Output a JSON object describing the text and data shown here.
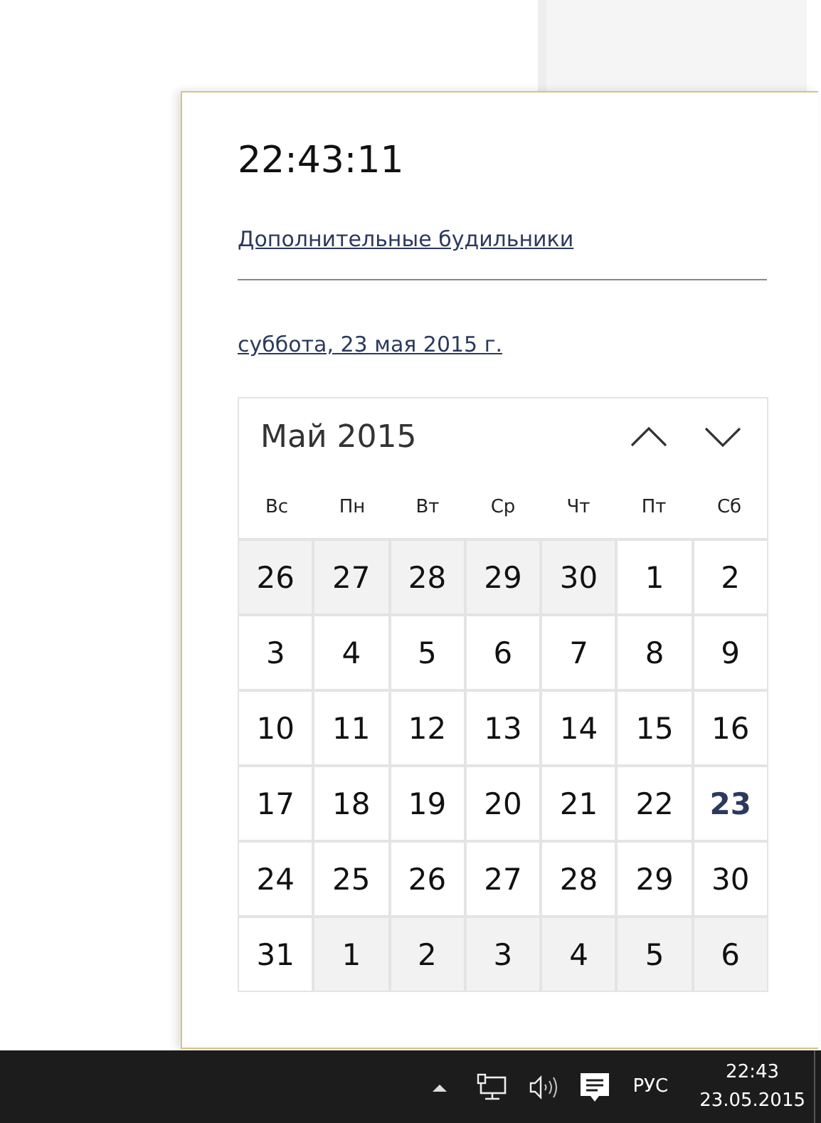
{
  "clock": {
    "time": "22:43:11",
    "alarms_link": "Дополнительные будильники",
    "date_link": "суббота, 23 мая 2015 г."
  },
  "calendar": {
    "month": "Май 2015",
    "weekdays": [
      "Вс",
      "Пн",
      "Вт",
      "Ср",
      "Чт",
      "Пт",
      "Сб"
    ],
    "days": [
      {
        "label": "26",
        "kind": "other",
        "today": false
      },
      {
        "label": "27",
        "kind": "other",
        "today": false
      },
      {
        "label": "28",
        "kind": "other",
        "today": false
      },
      {
        "label": "29",
        "kind": "other",
        "today": false
      },
      {
        "label": "30",
        "kind": "other",
        "today": false
      },
      {
        "label": "1",
        "kind": "current",
        "today": false
      },
      {
        "label": "2",
        "kind": "current",
        "today": false
      },
      {
        "label": "3",
        "kind": "current",
        "today": false
      },
      {
        "label": "4",
        "kind": "current",
        "today": false
      },
      {
        "label": "5",
        "kind": "current",
        "today": false
      },
      {
        "label": "6",
        "kind": "current",
        "today": false
      },
      {
        "label": "7",
        "kind": "current",
        "today": false
      },
      {
        "label": "8",
        "kind": "current",
        "today": false
      },
      {
        "label": "9",
        "kind": "current",
        "today": false
      },
      {
        "label": "10",
        "kind": "current",
        "today": false
      },
      {
        "label": "11",
        "kind": "current",
        "today": false
      },
      {
        "label": "12",
        "kind": "current",
        "today": false
      },
      {
        "label": "13",
        "kind": "current",
        "today": false
      },
      {
        "label": "14",
        "kind": "current",
        "today": false
      },
      {
        "label": "15",
        "kind": "current",
        "today": false
      },
      {
        "label": "16",
        "kind": "current",
        "today": false
      },
      {
        "label": "17",
        "kind": "current",
        "today": false
      },
      {
        "label": "18",
        "kind": "current",
        "today": false
      },
      {
        "label": "19",
        "kind": "current",
        "today": false
      },
      {
        "label": "20",
        "kind": "current",
        "today": false
      },
      {
        "label": "21",
        "kind": "current",
        "today": false
      },
      {
        "label": "22",
        "kind": "current",
        "today": false
      },
      {
        "label": "23",
        "kind": "current",
        "today": true
      },
      {
        "label": "24",
        "kind": "current",
        "today": false
      },
      {
        "label": "25",
        "kind": "current",
        "today": false
      },
      {
        "label": "26",
        "kind": "current",
        "today": false
      },
      {
        "label": "27",
        "kind": "current",
        "today": false
      },
      {
        "label": "28",
        "kind": "current",
        "today": false
      },
      {
        "label": "29",
        "kind": "current",
        "today": false
      },
      {
        "label": "30",
        "kind": "current",
        "today": false
      },
      {
        "label": "31",
        "kind": "current",
        "today": false
      },
      {
        "label": "1",
        "kind": "other",
        "today": false
      },
      {
        "label": "2",
        "kind": "other",
        "today": false
      },
      {
        "label": "3",
        "kind": "other",
        "today": false
      },
      {
        "label": "4",
        "kind": "other",
        "today": false
      },
      {
        "label": "5",
        "kind": "other",
        "today": false
      },
      {
        "label": "6",
        "kind": "other",
        "today": false
      }
    ]
  },
  "taskbar": {
    "language": "РУС",
    "time": "22:43",
    "date": "23.05.2015"
  }
}
